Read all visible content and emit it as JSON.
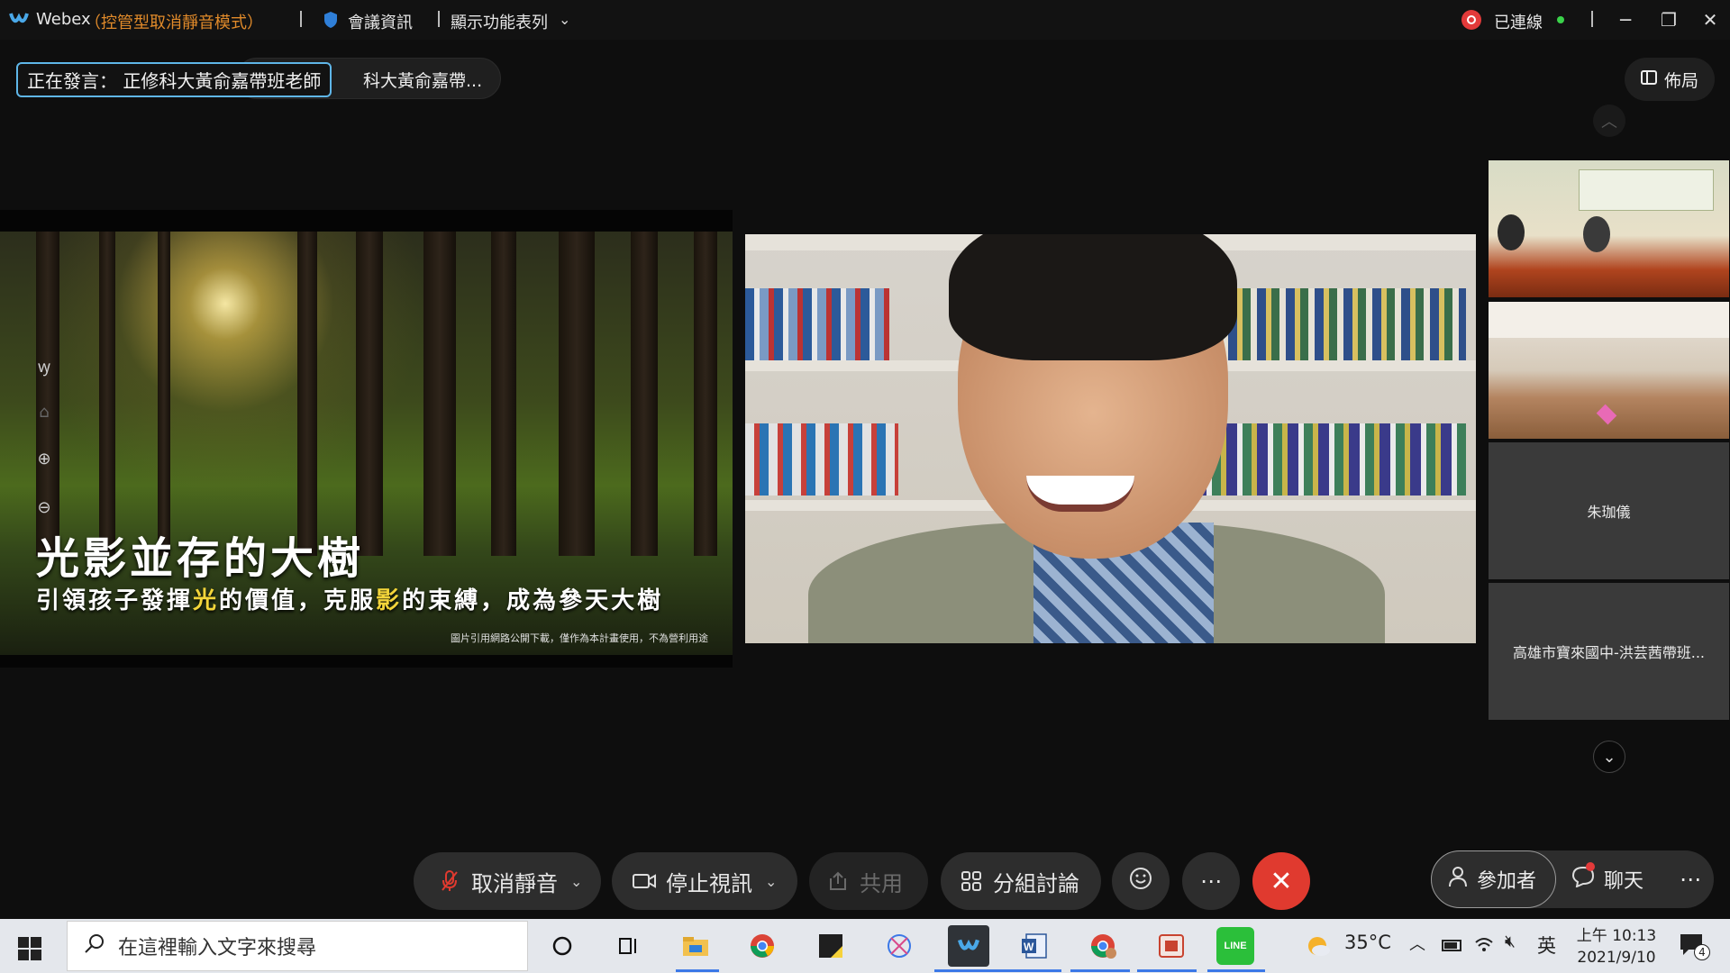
{
  "titlebar": {
    "app_name": "Webex",
    "mode": "（控管型取消靜音模式）",
    "meeting_info": "會議資訊",
    "show_menu": "顯示功能表列",
    "status": "已連線"
  },
  "speaking": {
    "label": "正在發言： 正修科大黃俞嘉帶班老師",
    "tag": "科大黃俞嘉帶..."
  },
  "layout_button": "佈局",
  "slide": {
    "title": "光影並存的大樹",
    "subtitle_parts": [
      "引領孩子發揮",
      "光",
      "的價值，克服",
      "影",
      "的束縛，成為參天大樹"
    ],
    "credit": "圖片引用網路公開下載，僅作為本計畫使用，不為營利用途"
  },
  "participants": {
    "tile3_name": "朱珈儀",
    "tile4_name": "高雄市寶來國中-洪芸茜帶班..."
  },
  "controls": {
    "unmute": "取消靜音",
    "stop_video": "停止視訊",
    "share": "共用",
    "breakout": "分組討論",
    "participants": "參加者",
    "chat": "聊天"
  },
  "taskbar": {
    "search_placeholder": "在這裡輸入文字來搜尋",
    "weather": "35°C",
    "ime": "英",
    "time": "上午 10:13",
    "date": "2021/9/10",
    "notifications": "4"
  },
  "colors": {
    "accent": "#5fb6e8",
    "end_call": "#e03a2f",
    "mode_text": "#e08a2a",
    "connected_dot": "#3ad24a"
  }
}
